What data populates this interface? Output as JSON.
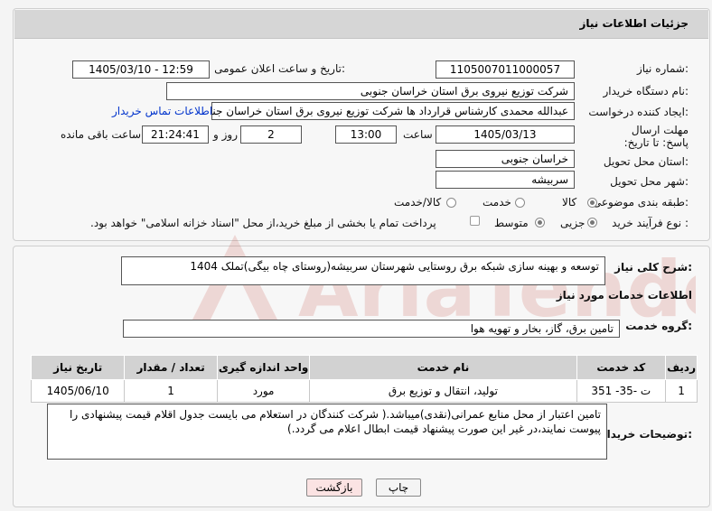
{
  "header": {
    "title": "جزئیات اطلاعات نیاز"
  },
  "form": {
    "need_number": {
      "label": "شماره نیاز:",
      "value": "1105007011000057"
    },
    "announce_datetime": {
      "label": "تاریخ و ساعت اعلان عمومی:",
      "value": "1405/03/10 - 12:59"
    },
    "buyer_org": {
      "label": "نام دستگاه خریدار:",
      "value": "شرکت توزیع نیروی برق استان خراسان جنوبی"
    },
    "requester": {
      "label": "ایجاد کننده درخواست:",
      "value": "عبدالله محمدی کارشناس قرارداد ها شرکت توزیع نیروی برق استان خراسان جنوبی",
      "contact_link": "اطلاعات تماس خریدار"
    },
    "deadline": {
      "label": "مهلت ارسال پاسخ: تا تاریخ:",
      "date": "1405/03/13",
      "time_label": "ساعت",
      "time": "13:00",
      "days": "2",
      "days_label": "روز و",
      "remaining": "21:24:41",
      "remaining_label": "ساعت باقی مانده"
    },
    "province": {
      "label": "استان محل تحویل:",
      "value": "خراسان جنوبی"
    },
    "city": {
      "label": "شهر محل تحویل:",
      "value": "سربیشه"
    },
    "category": {
      "label": "طبقه بندی موضوعی:",
      "options": [
        "کالا",
        "خدمت",
        "کالا/خدمت"
      ],
      "selected": "کالا"
    },
    "process": {
      "label": "نوع فرآیند خرید :",
      "options": [
        "جزیی",
        "متوسط"
      ],
      "selected": "جزیی",
      "note": "پرداخت تمام یا بخشی از مبلغ خرید،از محل \"اسناد خزانه اسلامی\" خواهد بود."
    }
  },
  "details": {
    "summary_label": "شرح کلی نیاز:",
    "summary_value": "توسعه و بهینه سازی شبکه برق روستایی شهرستان سربیشه(روستای چاه بیگی)تملک 1404",
    "services_title": "اطلاعات خدمات مورد نیاز",
    "service_group_label": "گروه خدمت:",
    "service_group_value": "تامین برق، گاز، بخار و تهویه هوا",
    "table": {
      "headers": [
        "ردیف",
        "کد خدمت",
        "نام خدمت",
        "واحد اندازه گیری",
        "تعداد / مقدار",
        "تاریخ نیاز"
      ],
      "rows": [
        [
          "1",
          "ت -35- 351",
          "تولید، انتقال و توزیع برق",
          "مورد",
          "1",
          "1405/06/10"
        ]
      ]
    },
    "buyer_notes_label": "توضیحات خریدار:",
    "buyer_notes_value": "تامین اعتبار از محل منابع عمرانی(نقدی)میباشد.( شرکت کنندگان در استعلام می بایست جدول اقلام قیمت پیشنهادی را پیوست نمایند،در غیر این صورت پیشنهاد قیمت ابطال اعلام می گردد.)"
  },
  "buttons": {
    "print": "چاپ",
    "back": "بازگشت"
  },
  "watermark": {
    "text": "AriaTender.net"
  },
  "colors": {
    "link": "#0033cc",
    "back_button": "#fbe3e3",
    "header_bg": "#d6d6d6",
    "watermark": "#c0392b"
  }
}
